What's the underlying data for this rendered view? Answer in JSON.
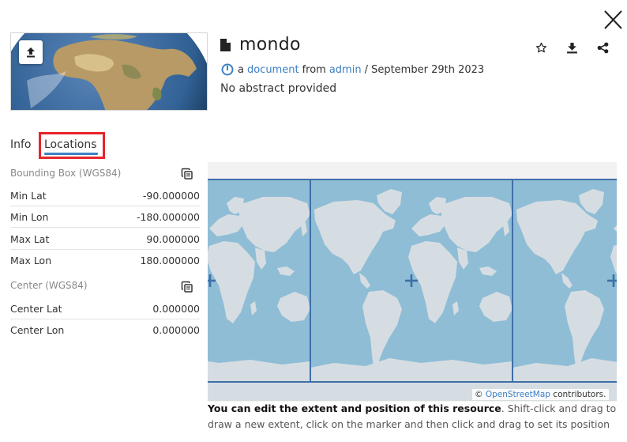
{
  "resource": {
    "title": "mondo",
    "meta_prefix": "a",
    "type_link": "document",
    "from_word": "from",
    "owner_link": "admin",
    "date": "/ September 29th 2023",
    "abstract": "No abstract provided"
  },
  "tabs": [
    {
      "label": "Info",
      "active": false
    },
    {
      "label": "Locations",
      "active": true
    }
  ],
  "bbox": {
    "heading": "Bounding Box (WGS84)",
    "rows": [
      {
        "label": "Min Lat",
        "value": "-90.000000"
      },
      {
        "label": "Min Lon",
        "value": "-180.000000"
      },
      {
        "label": "Max Lat",
        "value": "90.000000"
      },
      {
        "label": "Max Lon",
        "value": "180.000000"
      }
    ]
  },
  "center": {
    "heading": "Center (WGS84)",
    "rows": [
      {
        "label": "Center Lat",
        "value": "0.000000"
      },
      {
        "label": "Center Lon",
        "value": "0.000000"
      }
    ]
  },
  "map": {
    "attribution_prefix": "©",
    "attribution_link": "OpenStreetMap",
    "attribution_suffix": "contributors."
  },
  "help": {
    "bold": "You can edit the extent and position of this resource",
    "rest": ". Shift-click and drag to draw a new extent, click on the marker and then click and drag to set its position"
  },
  "icons": {
    "close": "close-icon",
    "upload": "upload-icon",
    "document": "document-icon",
    "star": "star-icon",
    "download": "download-icon",
    "share": "share-icon",
    "geonode": "geonode-icon",
    "copy": "copy-icon",
    "marker": "plus-marker-icon"
  },
  "colors": {
    "accent": "#3d80c4",
    "highlight": "#e8242b",
    "ocean": "#8fbdd6",
    "land": "#d6dde2"
  }
}
